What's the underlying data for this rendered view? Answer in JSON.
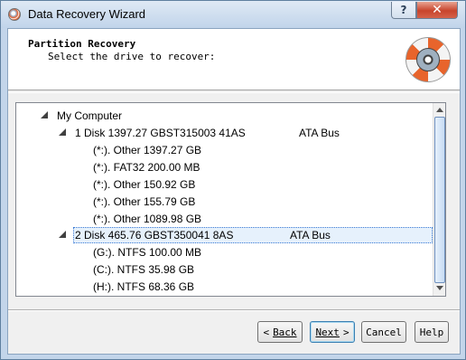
{
  "window": {
    "title": "Data Recovery Wizard",
    "help_glyph": "?",
    "close_glyph": "✕"
  },
  "header": {
    "title": "Partition Recovery",
    "subtitle": "Select the drive to recover:"
  },
  "tree": {
    "root": "My Computer",
    "disk1": {
      "label": "1 Disk 1397.27 GBST315003 41AS",
      "bus": "ATA Bus"
    },
    "disk1_partitions": [
      "(*:). Other 1397.27 GB",
      "(*:). FAT32 200.00 MB",
      "(*:). Other 150.92 GB",
      "(*:). Other 155.79 GB",
      "(*:). Other 1089.98 GB"
    ],
    "disk2": {
      "label": "2 Disk 465.76 GBST350041 8AS",
      "bus": "ATA Bus",
      "selected": true
    },
    "disk2_partitions": [
      "(G:). NTFS 100.00 MB",
      "(C:). NTFS 35.98 GB",
      "(H:). NTFS 68.36 GB"
    ]
  },
  "buttons": {
    "back_arrow": "<",
    "back": "Back",
    "next": "Next",
    "next_arrow": ">",
    "cancel": "Cancel",
    "help": "Help"
  }
}
